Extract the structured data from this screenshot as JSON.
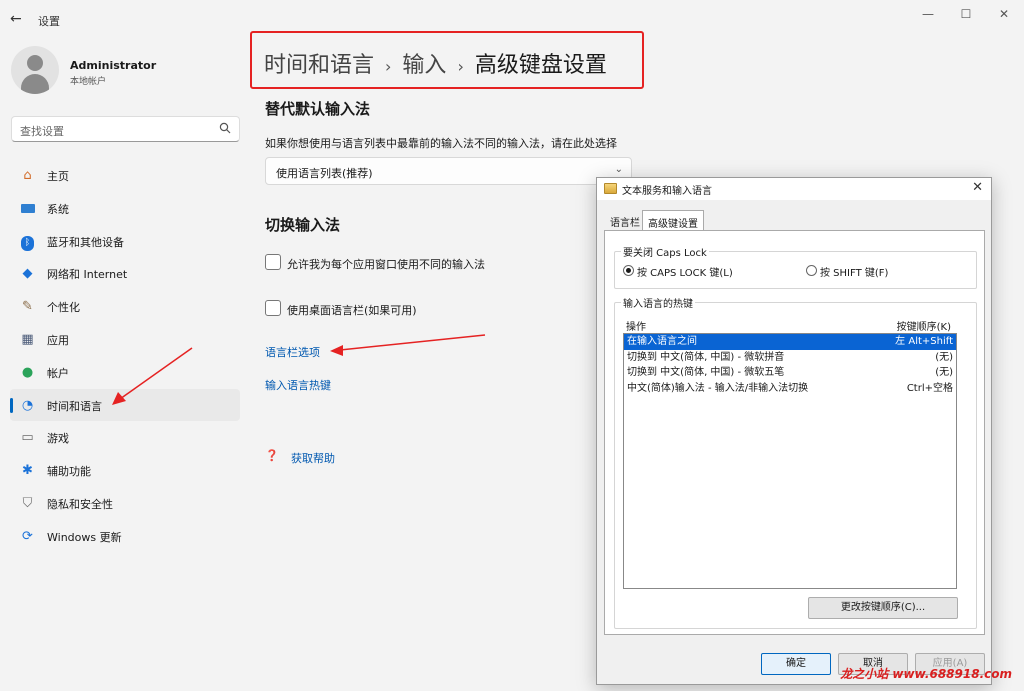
{
  "window": {
    "title": "设置"
  },
  "user": {
    "name": "Administrator",
    "account_type": "本地帐户"
  },
  "search": {
    "placeholder": "查找设置"
  },
  "sidebar": {
    "items": [
      {
        "label": "主页",
        "icon": "home-icon"
      },
      {
        "label": "系统",
        "icon": "system-icon"
      },
      {
        "label": "蓝牙和其他设备",
        "icon": "bluetooth-icon"
      },
      {
        "label": "网络和 Internet",
        "icon": "wifi-icon"
      },
      {
        "label": "个性化",
        "icon": "brush-icon"
      },
      {
        "label": "应用",
        "icon": "apps-icon"
      },
      {
        "label": "帐户",
        "icon": "account-icon"
      },
      {
        "label": "时间和语言",
        "icon": "clock-globe-icon",
        "active": true
      },
      {
        "label": "游戏",
        "icon": "gamepad-icon"
      },
      {
        "label": "辅助功能",
        "icon": "accessibility-icon"
      },
      {
        "label": "隐私和安全性",
        "icon": "shield-icon"
      },
      {
        "label": "Windows 更新",
        "icon": "update-icon"
      }
    ]
  },
  "breadcrumb": {
    "level1": "时间和语言",
    "level2": "输入",
    "current": "高级键盘设置",
    "separator": "›"
  },
  "override_section": {
    "title": "替代默认输入法",
    "description": "如果你想使用与语言列表中最靠前的输入法不同的输入法，请在此处选择",
    "selected": "使用语言列表(推荐)"
  },
  "switch_section": {
    "title": "切换输入法",
    "checkbox1": "允许我为每个应用窗口使用不同的输入法",
    "checkbox2": "使用桌面语言栏(如果可用)",
    "link_language_bar": "语言栏选项",
    "link_hotkeys": "输入语言热键"
  },
  "help": {
    "label": "获取帮助"
  },
  "dialog": {
    "title": "文本服务和输入语言",
    "tabs": [
      "语言栏",
      "高级键设置"
    ],
    "caps_group": {
      "label": "要关闭 Caps Lock",
      "option1": "按 CAPS LOCK 键(L)",
      "option2": "按 SHIFT 键(F)"
    },
    "hotkeys_group": {
      "label": "输入语言的热键",
      "col_action": "操作",
      "col_sequence": "按键顺序(K)",
      "rows": [
        {
          "action": "在输入语言之间",
          "sequence": "左 Alt+Shift",
          "selected": true
        },
        {
          "action": "切换到 中文(简体, 中国) - 微软拼音",
          "sequence": "(无)"
        },
        {
          "action": "切换到 中文(简体, 中国) - 微软五笔",
          "sequence": "(无)"
        },
        {
          "action": "中文(简体)输入法 - 输入法/非输入法切换",
          "sequence": "Ctrl+空格"
        }
      ],
      "change_button": "更改按键顺序(C)..."
    },
    "buttons": {
      "ok": "确定",
      "cancel": "取消",
      "apply": "应用(A)"
    }
  },
  "watermark": "龙之小站 www.688918.com",
  "colors": {
    "accent": "#0067c0",
    "highlight_box": "#e52222",
    "link": "#0058b0"
  }
}
